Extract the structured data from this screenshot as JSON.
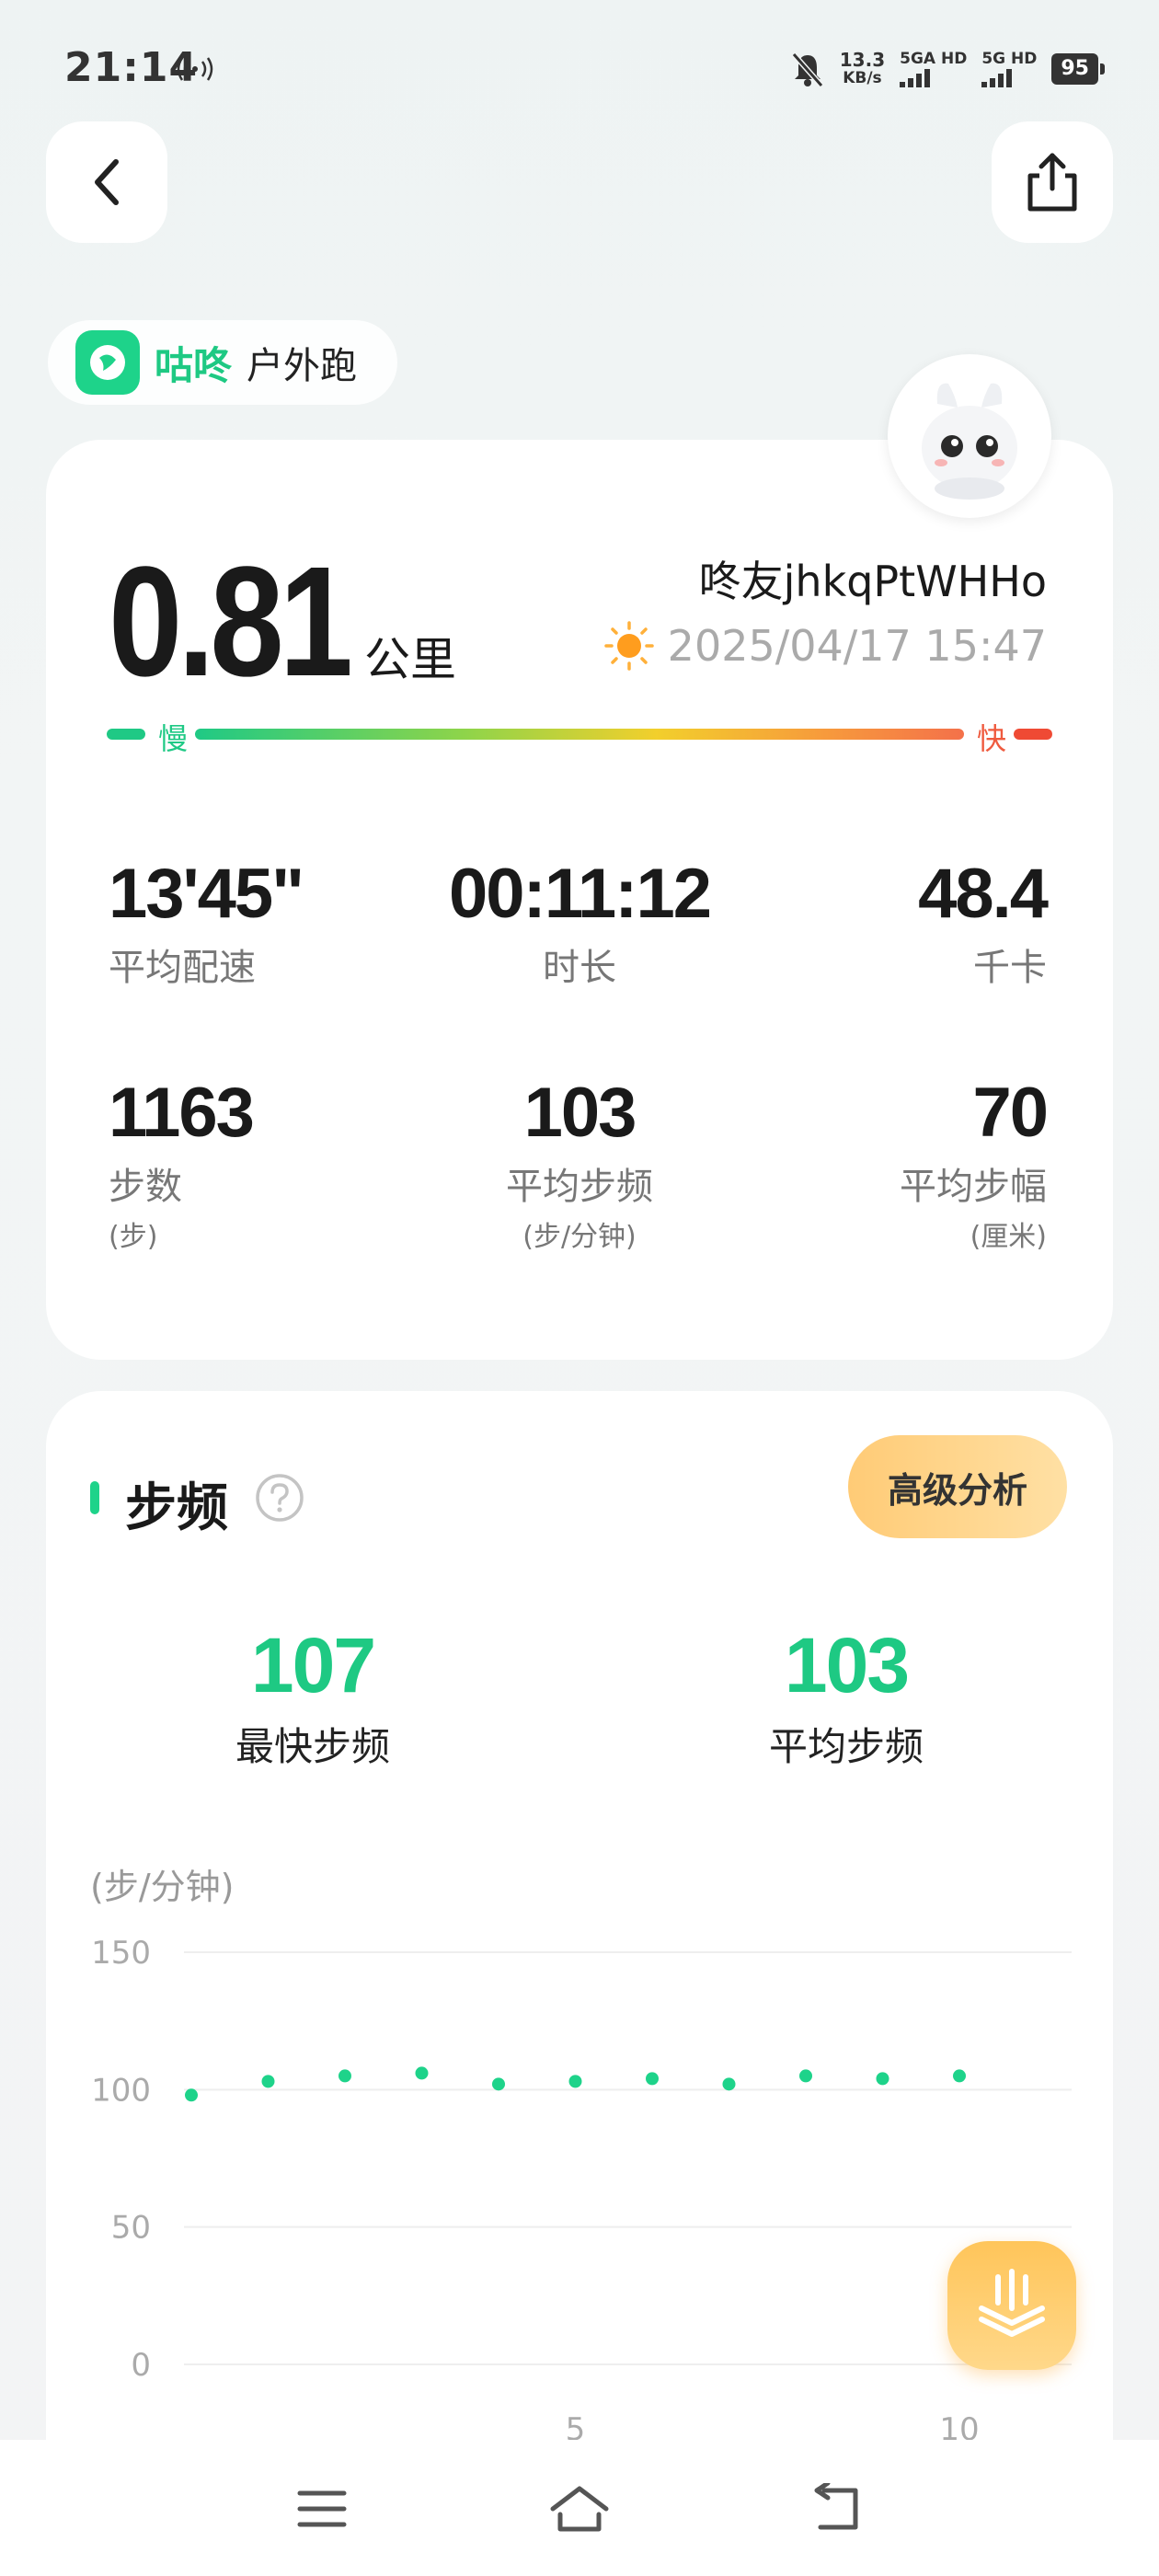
{
  "status_bar": {
    "time": "21:14",
    "net_speed_value": "13.3",
    "net_speed_unit": "KB/s",
    "sim1_label": "5GA HD",
    "sim2_label": "5G HD",
    "battery": "95"
  },
  "header": {
    "back_icon": "chevron-left-icon",
    "share_icon": "share-icon"
  },
  "source": {
    "app_name": "咕咚",
    "sport_type": "户外跑"
  },
  "summary": {
    "distance": "0.81",
    "distance_unit": "公里",
    "user_name": "咚友jhkqPtWHHo",
    "datetime": "2025/04/17 15:47",
    "weather_icon": "sun-icon",
    "pace_slow_label": "慢",
    "pace_fast_label": "快",
    "metrics": [
      {
        "value": "13'45\"",
        "label": "平均配速",
        "unit": ""
      },
      {
        "value": "00:11:12",
        "label": "时长",
        "unit": ""
      },
      {
        "value": "48.4",
        "label": "千卡",
        "unit": ""
      },
      {
        "value": "1163",
        "label": "步数",
        "unit": "(步)"
      },
      {
        "value": "103",
        "label": "平均步频",
        "unit": "(步/分钟)"
      },
      {
        "value": "70",
        "label": "平均步幅",
        "unit": "(厘米)"
      }
    ]
  },
  "cadence": {
    "title": "步频",
    "advanced_button": "高级分析",
    "fastest_value": "107",
    "fastest_label": "最快步频",
    "average_value": "103",
    "average_label": "平均步频",
    "unit_label": "(步/分钟)"
  },
  "chart_data": {
    "type": "scatter",
    "ylabel": "(步/分钟)",
    "ylim": [
      0,
      150
    ],
    "y_ticks": [
      "0",
      "50",
      "100",
      "150"
    ],
    "x_ticks": [
      "5",
      "10"
    ],
    "x": [
      0,
      1,
      2,
      3,
      4,
      5,
      6,
      7,
      8,
      9,
      10
    ],
    "values": [
      98,
      103,
      105,
      106,
      102,
      103,
      104,
      102,
      105,
      104,
      105
    ],
    "color": "#1ed38a",
    "grid": true
  },
  "colors": {
    "accent": "#1ed38a",
    "slow": "#1fc985",
    "fast": "#ef5a3e",
    "advanced_button": "#ffcb76"
  }
}
